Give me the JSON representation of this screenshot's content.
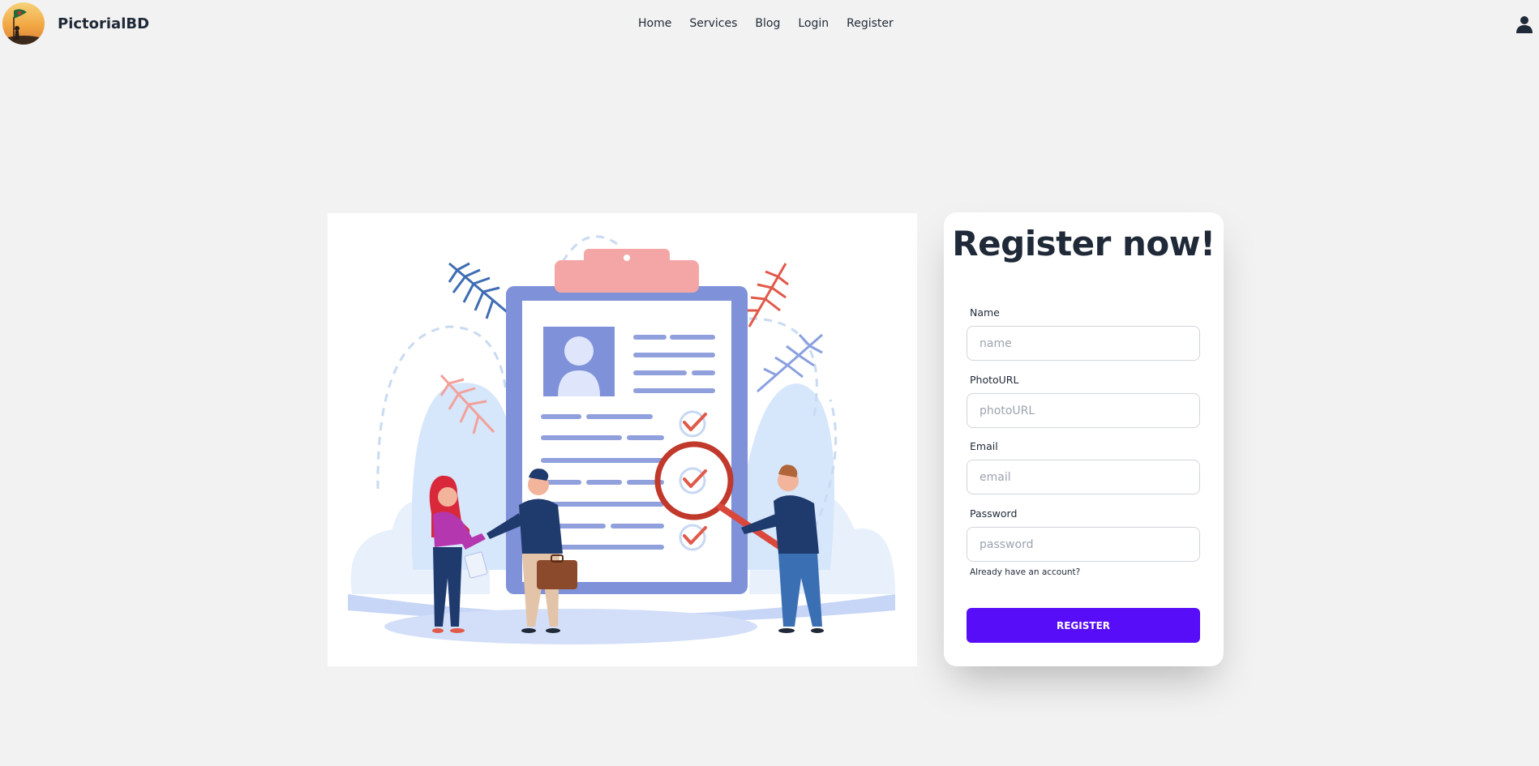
{
  "navbar": {
    "brand": "PictorialBD",
    "links": [
      "Home",
      "Services",
      "Blog",
      "Login",
      "Register"
    ],
    "user_icon": "user-icon"
  },
  "form": {
    "title": "Register now!",
    "fields": [
      {
        "label": "Name",
        "placeholder": "name",
        "value": ""
      },
      {
        "label": "PhotoURL",
        "placeholder": "photoURL",
        "value": ""
      },
      {
        "label": "Email",
        "placeholder": "email",
        "value": ""
      },
      {
        "label": "Password",
        "placeholder": "password",
        "value": ""
      }
    ],
    "account_link": "Already have an account?",
    "submit_label": "REGISTER"
  },
  "colors": {
    "background": "#f2f2f2",
    "primary": "#570df8",
    "text": "#1f2937"
  }
}
